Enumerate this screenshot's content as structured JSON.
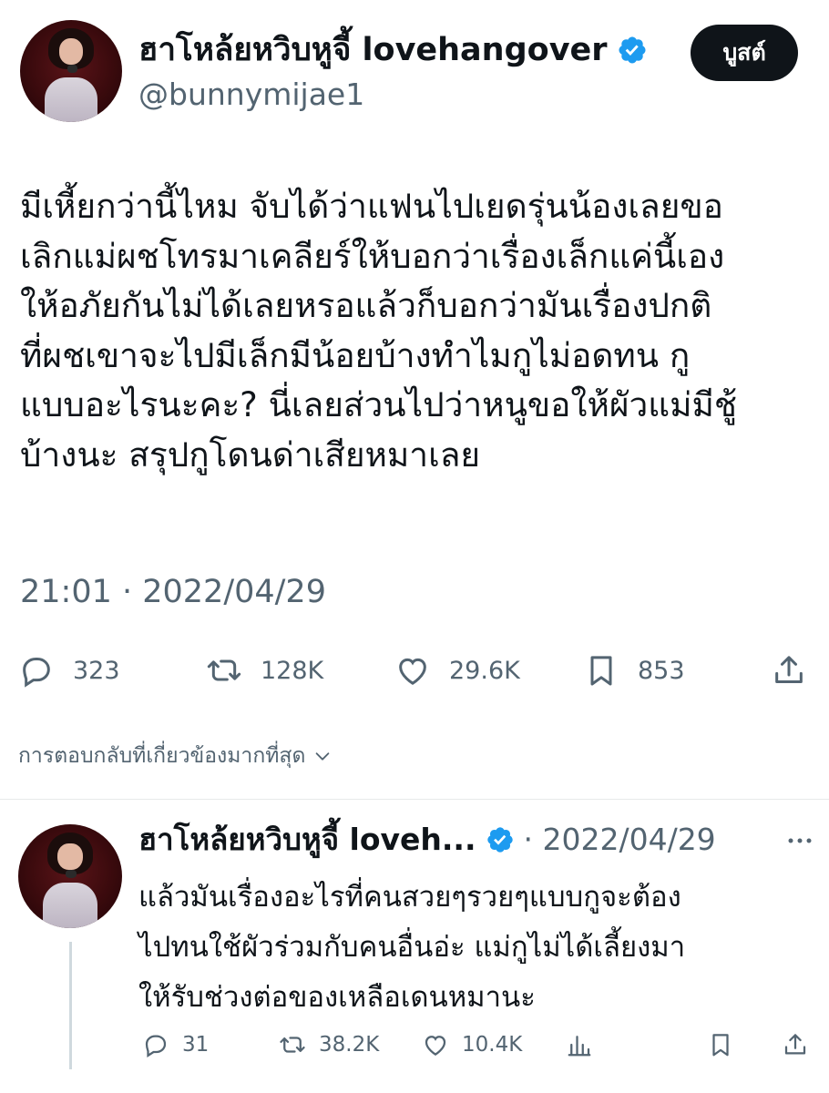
{
  "header": {
    "display_name": "ฮาโหล้ยหวิบหูจี้ lovehangover",
    "handle": "@bunnymijae1",
    "boost_label": "บูสต์"
  },
  "tweet": {
    "lines": [
      "มีเหี้ยกว่านี้ไหม จับได้ว่าแฟนไปเยดรุ่นน้องเลยขอ",
      "เลิกแม่ผชโทรมาเคลียร์ให้บอกว่าเรื่องเล็กแค่นี้เอง",
      "ให้อภัยกันไม่ได้เลยหรอแล้วก็บอกว่ามันเรื่องปกติ",
      "ที่ผชเขาจะไปมีเล็กมีน้อยบ้างทำไมกูไม่อดทน กู",
      "แบบอะไรนะคะ? นี่เลยส่วนไปว่าหนูขอให้ผัวแม่มีชู้",
      "บ้างนะ สรุปกูโดนด่าเสียหมาเลย"
    ],
    "timestamp": "21:01 · 2022/04/29"
  },
  "stats": {
    "replies": "323",
    "reposts": "128K",
    "likes": "29.6K",
    "bookmarks": "853"
  },
  "relevance_label": "การตอบกลับที่เกี่ยวข้องมากที่สุด",
  "reply": {
    "display_name": "ฮาโหล้ยหวิบหูจี้ loveh...",
    "date": "· 2022/04/29",
    "lines": [
      "แล้วมันเรื่องอะไรที่คนสวยๆรวยๆแบบกูจะต้อง",
      "ไปทนใช้ผัวร่วมกับคนอื่นอ่ะ แม่กูไม่ได้เลี้ยงมา",
      "ให้รับช่วงต่อของเหลือเดนหมานะ"
    ],
    "stats": {
      "replies": "31",
      "reposts": "38.2K",
      "likes": "10.4K"
    }
  },
  "icons": {
    "verified": "verified-badge-icon",
    "reply": "reply-bubble-icon",
    "repost": "repost-icon",
    "like": "heart-icon",
    "bookmark": "bookmark-icon",
    "share": "share-icon",
    "views": "analytics-icon",
    "more": "more-icon",
    "chevron": "chevron-down-icon"
  },
  "colors": {
    "verified_blue": "#1d9bf0",
    "muted": "#536471",
    "text": "#0f1419"
  }
}
